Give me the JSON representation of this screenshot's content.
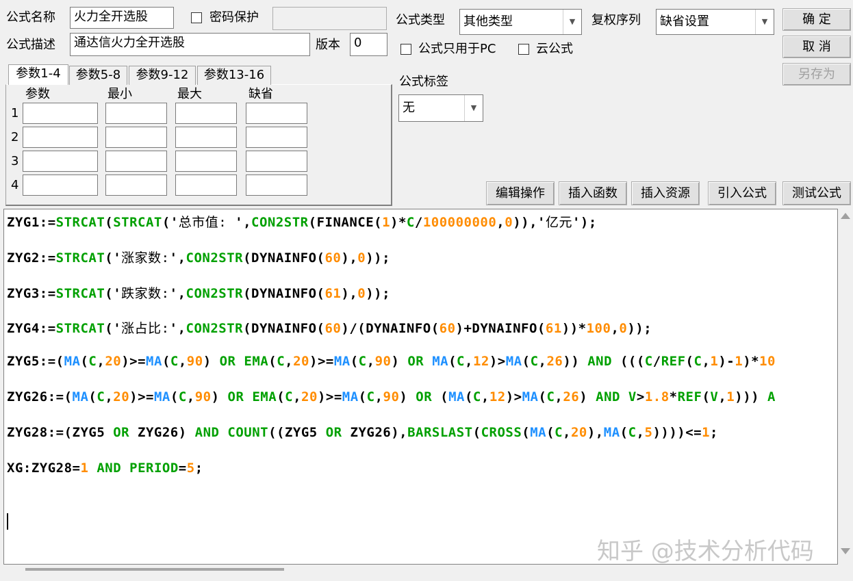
{
  "form": {
    "name_label": "公式名称",
    "name_value": "火力全开选股",
    "password_label": "密码保护",
    "password_value": "",
    "desc_label": "公式描述",
    "desc_value": "通达信火力全开选股",
    "version_label": "版本",
    "version_value": "0",
    "type_label": "公式类型",
    "type_value": "其他类型",
    "rights_label": "复权序列",
    "rights_value": "缺省设置",
    "pc_only_label": "公式只用于PC",
    "cloud_label": "云公式",
    "tag_label": "公式标签",
    "tag_value": "无"
  },
  "buttons": {
    "ok": "确  定",
    "cancel": "取  消",
    "save_as": "另存为",
    "edit_ops": "编辑操作",
    "insert_func": "插入函数",
    "insert_res": "插入资源",
    "import_formula": "引入公式",
    "test_formula": "测试公式"
  },
  "tabs": [
    "参数1-4",
    "参数5-8",
    "参数9-12",
    "参数13-16"
  ],
  "params": {
    "headers": [
      "参数",
      "最小",
      "最大",
      "缺省"
    ],
    "rows": [
      "1",
      "2",
      "3",
      "4"
    ]
  },
  "code": [
    [
      [
        "ZYG1:=",
        "k"
      ],
      [
        "STRCAT",
        "f"
      ],
      [
        "(",
        "k"
      ],
      [
        "STRCAT",
        "f"
      ],
      [
        "('",
        "k"
      ],
      [
        "总市值: ",
        "s"
      ],
      [
        "',",
        "k"
      ],
      [
        "CON2STR",
        "f"
      ],
      [
        "(FINANCE(",
        "k"
      ],
      [
        "1",
        "n"
      ],
      [
        ")*",
        "k"
      ],
      [
        "C",
        "f"
      ],
      [
        "/",
        "k"
      ],
      [
        "100000000",
        "n"
      ],
      [
        ",",
        "k"
      ],
      [
        "0",
        "n"
      ],
      [
        ")),'",
        "k"
      ],
      [
        "亿元",
        "s"
      ],
      [
        "');",
        "k"
      ]
    ],
    [
      [
        "ZYG2:=",
        "k"
      ],
      [
        "STRCAT",
        "f"
      ],
      [
        "('",
        "k"
      ],
      [
        "涨家数:",
        "s"
      ],
      [
        "',",
        "k"
      ],
      [
        "CON2STR",
        "f"
      ],
      [
        "(DYNAINFO(",
        "k"
      ],
      [
        "60",
        "n"
      ],
      [
        "),",
        "k"
      ],
      [
        "0",
        "n"
      ],
      [
        "));",
        "k"
      ]
    ],
    [
      [
        "ZYG3:=",
        "k"
      ],
      [
        "STRCAT",
        "f"
      ],
      [
        "('",
        "k"
      ],
      [
        "跌家数:",
        "s"
      ],
      [
        "',",
        "k"
      ],
      [
        "CON2STR",
        "f"
      ],
      [
        "(DYNAINFO(",
        "k"
      ],
      [
        "61",
        "n"
      ],
      [
        "),",
        "k"
      ],
      [
        "0",
        "n"
      ],
      [
        "));",
        "k"
      ]
    ],
    [
      [
        "ZYG4:=",
        "k"
      ],
      [
        "STRCAT",
        "f"
      ],
      [
        "('",
        "k"
      ],
      [
        "涨占比:",
        "s"
      ],
      [
        "',",
        "k"
      ],
      [
        "CON2STR",
        "f"
      ],
      [
        "(DYNAINFO(",
        "k"
      ],
      [
        "60",
        "n"
      ],
      [
        ")/(DYNAINFO(",
        "k"
      ],
      [
        "60",
        "n"
      ],
      [
        ")+DYNAINFO(",
        "k"
      ],
      [
        "61",
        "n"
      ],
      [
        "))*",
        "k"
      ],
      [
        "100",
        "n"
      ],
      [
        ",",
        "k"
      ],
      [
        "0",
        "n"
      ],
      [
        "));",
        "k"
      ]
    ],
    [
      [
        "ZYG5:=(",
        "k"
      ],
      [
        "MA",
        "b"
      ],
      [
        "(",
        "k"
      ],
      [
        "C",
        "f"
      ],
      [
        ",",
        "k"
      ],
      [
        "20",
        "n"
      ],
      [
        ")>=",
        "k"
      ],
      [
        "MA",
        "b"
      ],
      [
        "(",
        "k"
      ],
      [
        "C",
        "f"
      ],
      [
        ",",
        "k"
      ],
      [
        "90",
        "n"
      ],
      [
        ") ",
        "k"
      ],
      [
        "OR",
        "f"
      ],
      [
        " ",
        "k"
      ],
      [
        "EMA",
        "f"
      ],
      [
        "(",
        "k"
      ],
      [
        "C",
        "f"
      ],
      [
        ",",
        "k"
      ],
      [
        "20",
        "n"
      ],
      [
        ")>=",
        "k"
      ],
      [
        "MA",
        "b"
      ],
      [
        "(",
        "k"
      ],
      [
        "C",
        "f"
      ],
      [
        ",",
        "k"
      ],
      [
        "90",
        "n"
      ],
      [
        ") ",
        "k"
      ],
      [
        "OR",
        "f"
      ],
      [
        " ",
        "k"
      ],
      [
        "MA",
        "b"
      ],
      [
        "(",
        "k"
      ],
      [
        "C",
        "f"
      ],
      [
        ",",
        "k"
      ],
      [
        "12",
        "n"
      ],
      [
        ")>",
        "k"
      ],
      [
        "MA",
        "b"
      ],
      [
        "(",
        "k"
      ],
      [
        "C",
        "f"
      ],
      [
        ",",
        "k"
      ],
      [
        "26",
        "n"
      ],
      [
        ")) ",
        "k"
      ],
      [
        "AND",
        "f"
      ],
      [
        " (((",
        "k"
      ],
      [
        "C",
        "f"
      ],
      [
        "/",
        "k"
      ],
      [
        "REF",
        "f"
      ],
      [
        "(",
        "k"
      ],
      [
        "C",
        "f"
      ],
      [
        ",",
        "k"
      ],
      [
        "1",
        "n"
      ],
      [
        ")-",
        "k"
      ],
      [
        "1",
        "n"
      ],
      [
        ")*",
        "k"
      ],
      [
        "10",
        "n"
      ]
    ],
    [
      [
        "ZYG26:=(",
        "k"
      ],
      [
        "MA",
        "b"
      ],
      [
        "(",
        "k"
      ],
      [
        "C",
        "f"
      ],
      [
        ",",
        "k"
      ],
      [
        "20",
        "n"
      ],
      [
        ")>=",
        "k"
      ],
      [
        "MA",
        "b"
      ],
      [
        "(",
        "k"
      ],
      [
        "C",
        "f"
      ],
      [
        ",",
        "k"
      ],
      [
        "90",
        "n"
      ],
      [
        ") ",
        "k"
      ],
      [
        "OR",
        "f"
      ],
      [
        " ",
        "k"
      ],
      [
        "EMA",
        "f"
      ],
      [
        "(",
        "k"
      ],
      [
        "C",
        "f"
      ],
      [
        ",",
        "k"
      ],
      [
        "20",
        "n"
      ],
      [
        ")>=",
        "k"
      ],
      [
        "MA",
        "b"
      ],
      [
        "(",
        "k"
      ],
      [
        "C",
        "f"
      ],
      [
        ",",
        "k"
      ],
      [
        "90",
        "n"
      ],
      [
        ") ",
        "k"
      ],
      [
        "OR",
        "f"
      ],
      [
        " (",
        "k"
      ],
      [
        "MA",
        "b"
      ],
      [
        "(",
        "k"
      ],
      [
        "C",
        "f"
      ],
      [
        ",",
        "k"
      ],
      [
        "12",
        "n"
      ],
      [
        ")>",
        "k"
      ],
      [
        "MA",
        "b"
      ],
      [
        "(",
        "k"
      ],
      [
        "C",
        "f"
      ],
      [
        ",",
        "k"
      ],
      [
        "26",
        "n"
      ],
      [
        ") ",
        "k"
      ],
      [
        "AND",
        "f"
      ],
      [
        " ",
        "k"
      ],
      [
        "V",
        "f"
      ],
      [
        ">",
        "k"
      ],
      [
        "1.8",
        "n"
      ],
      [
        "*",
        "k"
      ],
      [
        "REF",
        "f"
      ],
      [
        "(",
        "k"
      ],
      [
        "V",
        "f"
      ],
      [
        ",",
        "k"
      ],
      [
        "1",
        "n"
      ],
      [
        "))) ",
        "k"
      ],
      [
        "A",
        "f"
      ]
    ],
    [
      [
        "ZYG28:=(ZYG5 ",
        "k"
      ],
      [
        "OR",
        "f"
      ],
      [
        " ZYG26) ",
        "k"
      ],
      [
        "AND",
        "f"
      ],
      [
        " ",
        "k"
      ],
      [
        "COUNT",
        "f"
      ],
      [
        "((ZYG5 ",
        "k"
      ],
      [
        "OR",
        "f"
      ],
      [
        " ZYG26),",
        "k"
      ],
      [
        "BARSLAST",
        "f"
      ],
      [
        "(",
        "k"
      ],
      [
        "CROSS",
        "f"
      ],
      [
        "(",
        "k"
      ],
      [
        "MA",
        "b"
      ],
      [
        "(",
        "k"
      ],
      [
        "C",
        "f"
      ],
      [
        ",",
        "k"
      ],
      [
        "20",
        "n"
      ],
      [
        "),",
        "k"
      ],
      [
        "MA",
        "b"
      ],
      [
        "(",
        "k"
      ],
      [
        "C",
        "f"
      ],
      [
        ",",
        "k"
      ],
      [
        "5",
        "n"
      ],
      [
        "))))<=",
        "k"
      ],
      [
        "1",
        "n"
      ],
      [
        ";",
        "k"
      ]
    ],
    [
      [
        "XG:ZYG28=",
        "k"
      ],
      [
        "1",
        "n"
      ],
      [
        " ",
        "k"
      ],
      [
        "AND",
        "f"
      ],
      [
        " ",
        "k"
      ],
      [
        "PERIOD",
        "f"
      ],
      [
        "=",
        "k"
      ],
      [
        "5",
        "n"
      ],
      [
        ";",
        "k"
      ]
    ]
  ],
  "watermark": "知乎 @技术分析代码"
}
